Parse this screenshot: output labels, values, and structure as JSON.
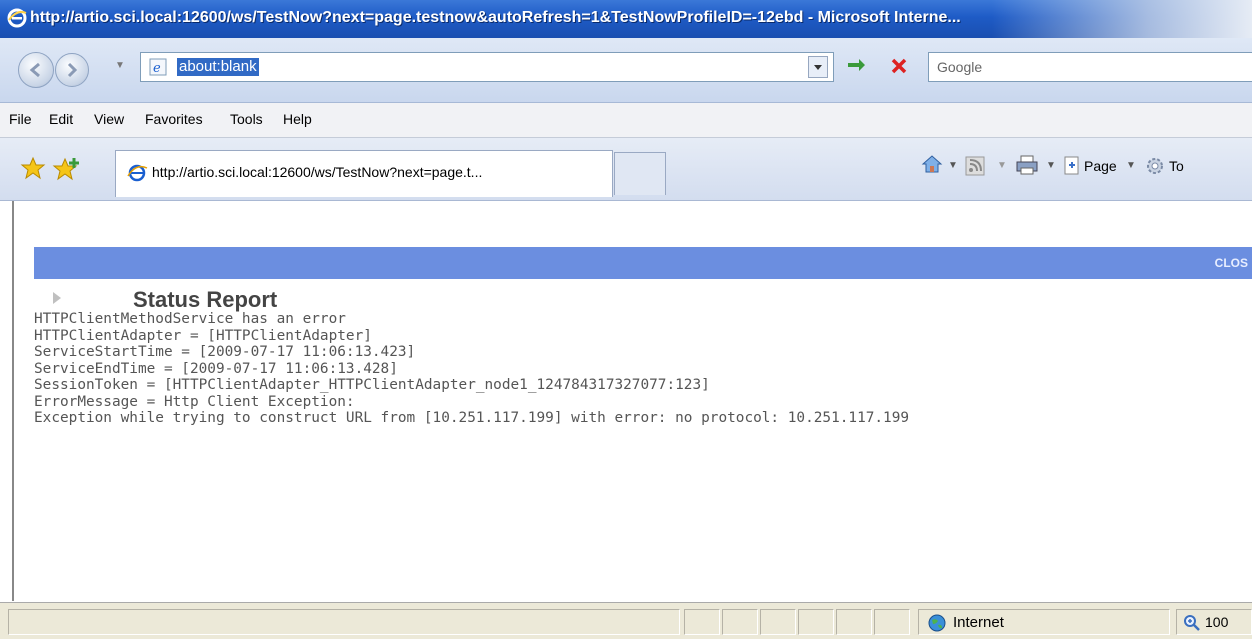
{
  "window": {
    "title": "http://artio.sci.local:12600/ws/TestNow?next=page.testnow&autoRefresh=1&TestNowProfileID=-12ebd - Microsoft Interne..."
  },
  "address_bar": {
    "url": "about:blank",
    "search_placeholder": "Google"
  },
  "menu": {
    "items": [
      "File",
      "Edit",
      "View",
      "Favorites",
      "Tools",
      "Help"
    ]
  },
  "tabs": {
    "active_label": "http://artio.sci.local:12600/ws/TestNow?next=page.t..."
  },
  "command_bar": {
    "page_label": "Page",
    "tools_label": "To"
  },
  "page": {
    "close_label": "CLOS",
    "title": "Status Report",
    "lines": [
      "HTTPClientMethodService has an error",
      "HTTPClientAdapter = [HTTPClientAdapter]",
      "ServiceStartTime = [2009-07-17 11:06:13.423]",
      "ServiceEndTime = [2009-07-17 11:06:13.428]",
      "SessionToken = [HTTPClientAdapter_HTTPClientAdapter_node1_124784317327077:123]",
      "ErrorMessage = Http Client Exception:",
      "Exception while trying to construct URL from [10.251.117.199] with error: no protocol: 10.251.117.199"
    ]
  },
  "status_bar": {
    "zone_label": "Internet",
    "zoom_label": "100"
  },
  "colors": {
    "titlebar": "#1e5bc6",
    "page_header_bar": "#6b8ee0",
    "selection": "#316ac5"
  }
}
